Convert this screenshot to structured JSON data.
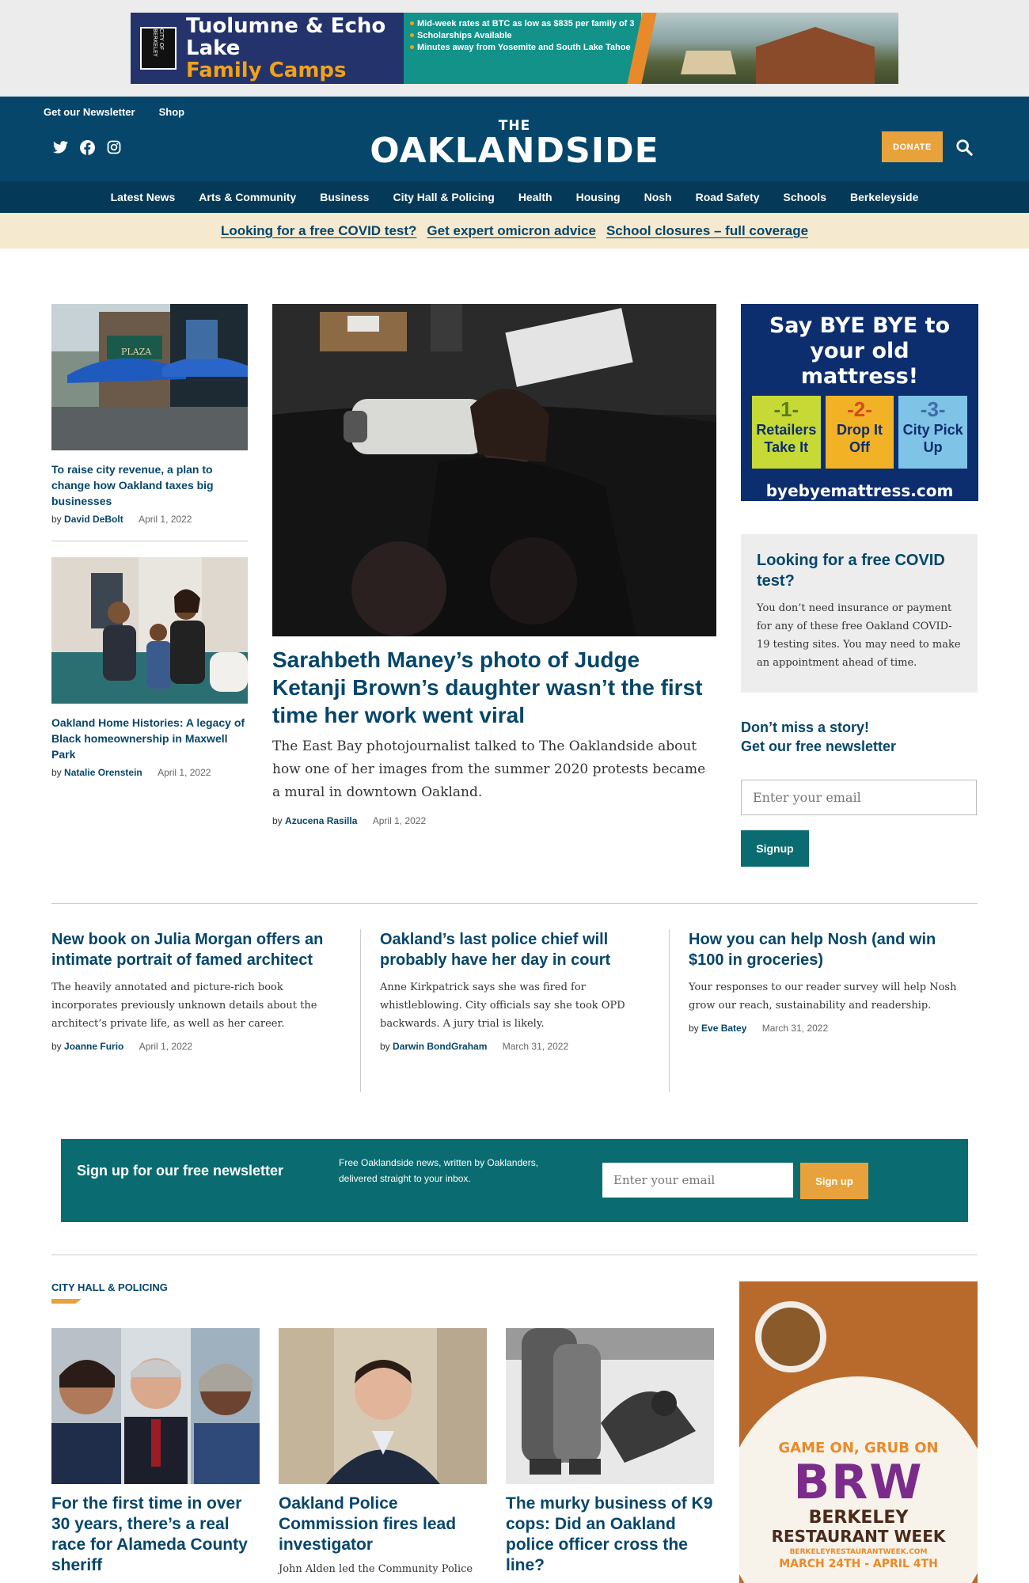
{
  "top_ad": {
    "badge": "CITY OF BERKELEY",
    "title_line1": "Tuolumne & Echo Lake",
    "title_line2": "Family Camps",
    "bullets": [
      "Mid-week rates at BTC as low as $835 per family of 3",
      "Scholarships Available",
      "Minutes away from Yosemite and South Lake Tahoe"
    ]
  },
  "header": {
    "util_links": [
      "Get our Newsletter",
      "Shop"
    ],
    "social_icons": [
      "twitter-icon",
      "facebook-icon",
      "instagram-icon"
    ],
    "logo_the": "THE",
    "logo_name": "OAKLANDSIDE",
    "donate_label": "DONATE"
  },
  "nav": {
    "items": [
      "Latest News",
      "Arts & Community",
      "Business",
      "City Hall & Policing",
      "Health",
      "Housing",
      "Nosh",
      "Road Safety",
      "Schools",
      "Berkeleyside"
    ]
  },
  "alert_links": [
    "Looking for a free COVID test?",
    "Get expert omicron advice",
    "School closures – full coverage"
  ],
  "left_stories": [
    {
      "title": "To raise city revenue, a plan to change how Oakland taxes big businesses",
      "by": "by",
      "author": "David DeBolt",
      "date": "April 1, 2022"
    },
    {
      "title": "Oakland Home Histories: A legacy of Black homeownership in Maxwell Park",
      "by": "by",
      "author": "Natalie Orenstein",
      "date": "April 1, 2022"
    }
  ],
  "hero": {
    "title": "Sarahbeth Maney’s photo of Judge Ketanji Brown’s daughter wasn’t the first time her work went viral",
    "dek": "The East Bay photojournalist talked to The Oaklandside about how one of her images from the summer 2020 protests became a mural in downtown Oakland.",
    "by": "by",
    "author": "Azucena Rasilla",
    "date": "April 1, 2022"
  },
  "mattress_ad": {
    "headline": "Say BYE BYE to your old mattress!",
    "steps": [
      {
        "num": "-1-",
        "label": "Retailers Take It"
      },
      {
        "num": "-2-",
        "label": "Drop It Off"
      },
      {
        "num": "-3-",
        "label": "City Pick Up"
      }
    ],
    "url": "byebyemattress.com"
  },
  "covid_box": {
    "title": "Looking for a free COVID test?",
    "body": "You don’t need insurance or payment for any of these free Oakland COVID-19 testing sites. You may need to make an appointment ahead of time."
  },
  "side_newsletter": {
    "title_line1": "Don’t miss a story!",
    "title_line2": "Get our free newsletter",
    "placeholder": "Enter your email",
    "button": "Signup"
  },
  "row3": [
    {
      "title": "New book on Julia Morgan offers an intimate portrait of famed architect",
      "dek": "The heavily annotated and picture-rich book incorporates previously unknown details about the architect’s private life, as well as her career.",
      "by": "by",
      "author": "Joanne Furio",
      "date": "April 1, 2022"
    },
    {
      "title": "Oakland’s last police chief will probably have her day in court",
      "dek": "Anne Kirkpatrick says she was fired for whistleblowing. City officials say she took OPD backwards. A jury trial is likely.",
      "by": "by",
      "author": "Darwin BondGraham",
      "date": "March 31, 2022"
    },
    {
      "title": "How you can help Nosh (and win $100 in groceries)",
      "dek": "Your responses to our reader survey will help Nosh grow our reach, sustainability and readership.",
      "by": "by",
      "author": "Eve Batey",
      "date": "March 31, 2022"
    }
  ],
  "nl_banner": {
    "title": "Sign up for our free newsletter",
    "desc": "Free Oaklandside news, written by Oaklanders, delivered straight to your inbox.",
    "placeholder": "Enter your email",
    "button": "Sign up"
  },
  "section": {
    "label": "CITY HALL & POLICING",
    "cards": [
      {
        "title": "For the first time in over 30 years, there’s a real race for Alameda County sheriff",
        "dek": ""
      },
      {
        "title": "Oakland Police Commission fires lead investigator",
        "dek": "John Alden led the Community Police"
      },
      {
        "title": "The murky business of K9 cops: Did an Oakland police officer cross the line?",
        "dek": ""
      }
    ]
  },
  "brw_ad": {
    "game_on": "GAME ON, GRUB ON",
    "brw": "BRW",
    "line1": "BERKELEY",
    "line2": "RESTAURANT WEEK",
    "url": "BERKELEYRESTAURANTWEEK.COM",
    "dates": "MARCH 24TH - APRIL 4TH"
  },
  "colors": {
    "brand_blue": "#05466a",
    "teal": "#0a6c71",
    "accent_orange": "#e8a23b",
    "alert_bg": "#f5e9cf"
  }
}
